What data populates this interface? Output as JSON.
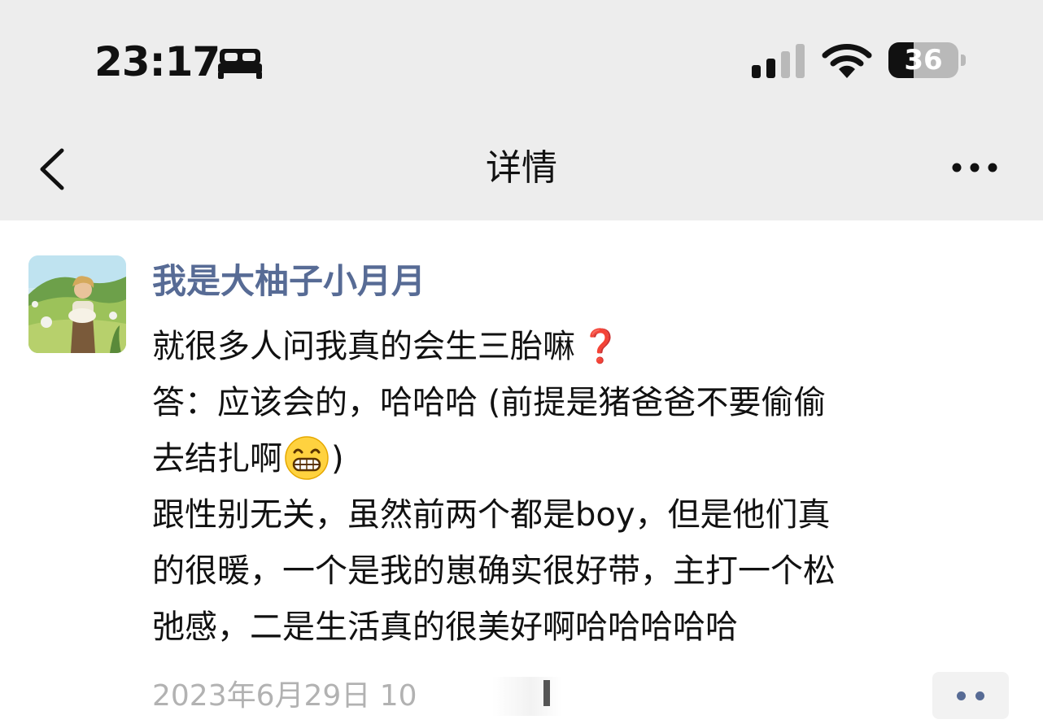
{
  "status_bar": {
    "time": "23:17",
    "sleep_icon": "bed-icon",
    "signal_bars_filled": 2,
    "signal_bars_total": 4,
    "battery_level": "36",
    "battery_fraction": 0.36
  },
  "nav": {
    "title": "详情",
    "back_icon": "chevron-left-icon",
    "more_icon": "ellipsis-icon"
  },
  "post": {
    "author": "我是大柚子小月月",
    "lines": {
      "l1": "就很多人问我真的会生三胎嘛",
      "l1_mark": "❓",
      "l2": "答：应该会的，哈哈哈 (前提是猪爸爸不要偷偷",
      "l3a": "去结扎啊",
      "l3b": ")",
      "l4": "跟性别无关，虽然前两个都是boy，但是他们真",
      "l5": "的很暖，一个是我的崽确实很好带，主打一个松",
      "l6": "弛感，二是生活真的很美好啊哈哈哈哈哈"
    },
    "emoji": "grinning-face-icon",
    "timestamp": "2023年6月29日 10",
    "comment_icon": "two-dots-icon"
  },
  "colors": {
    "nav_bg": "#ededed",
    "author_blue": "#576b95",
    "timestamp_gray": "#b2b2b2",
    "question_red": "#e0242a"
  }
}
